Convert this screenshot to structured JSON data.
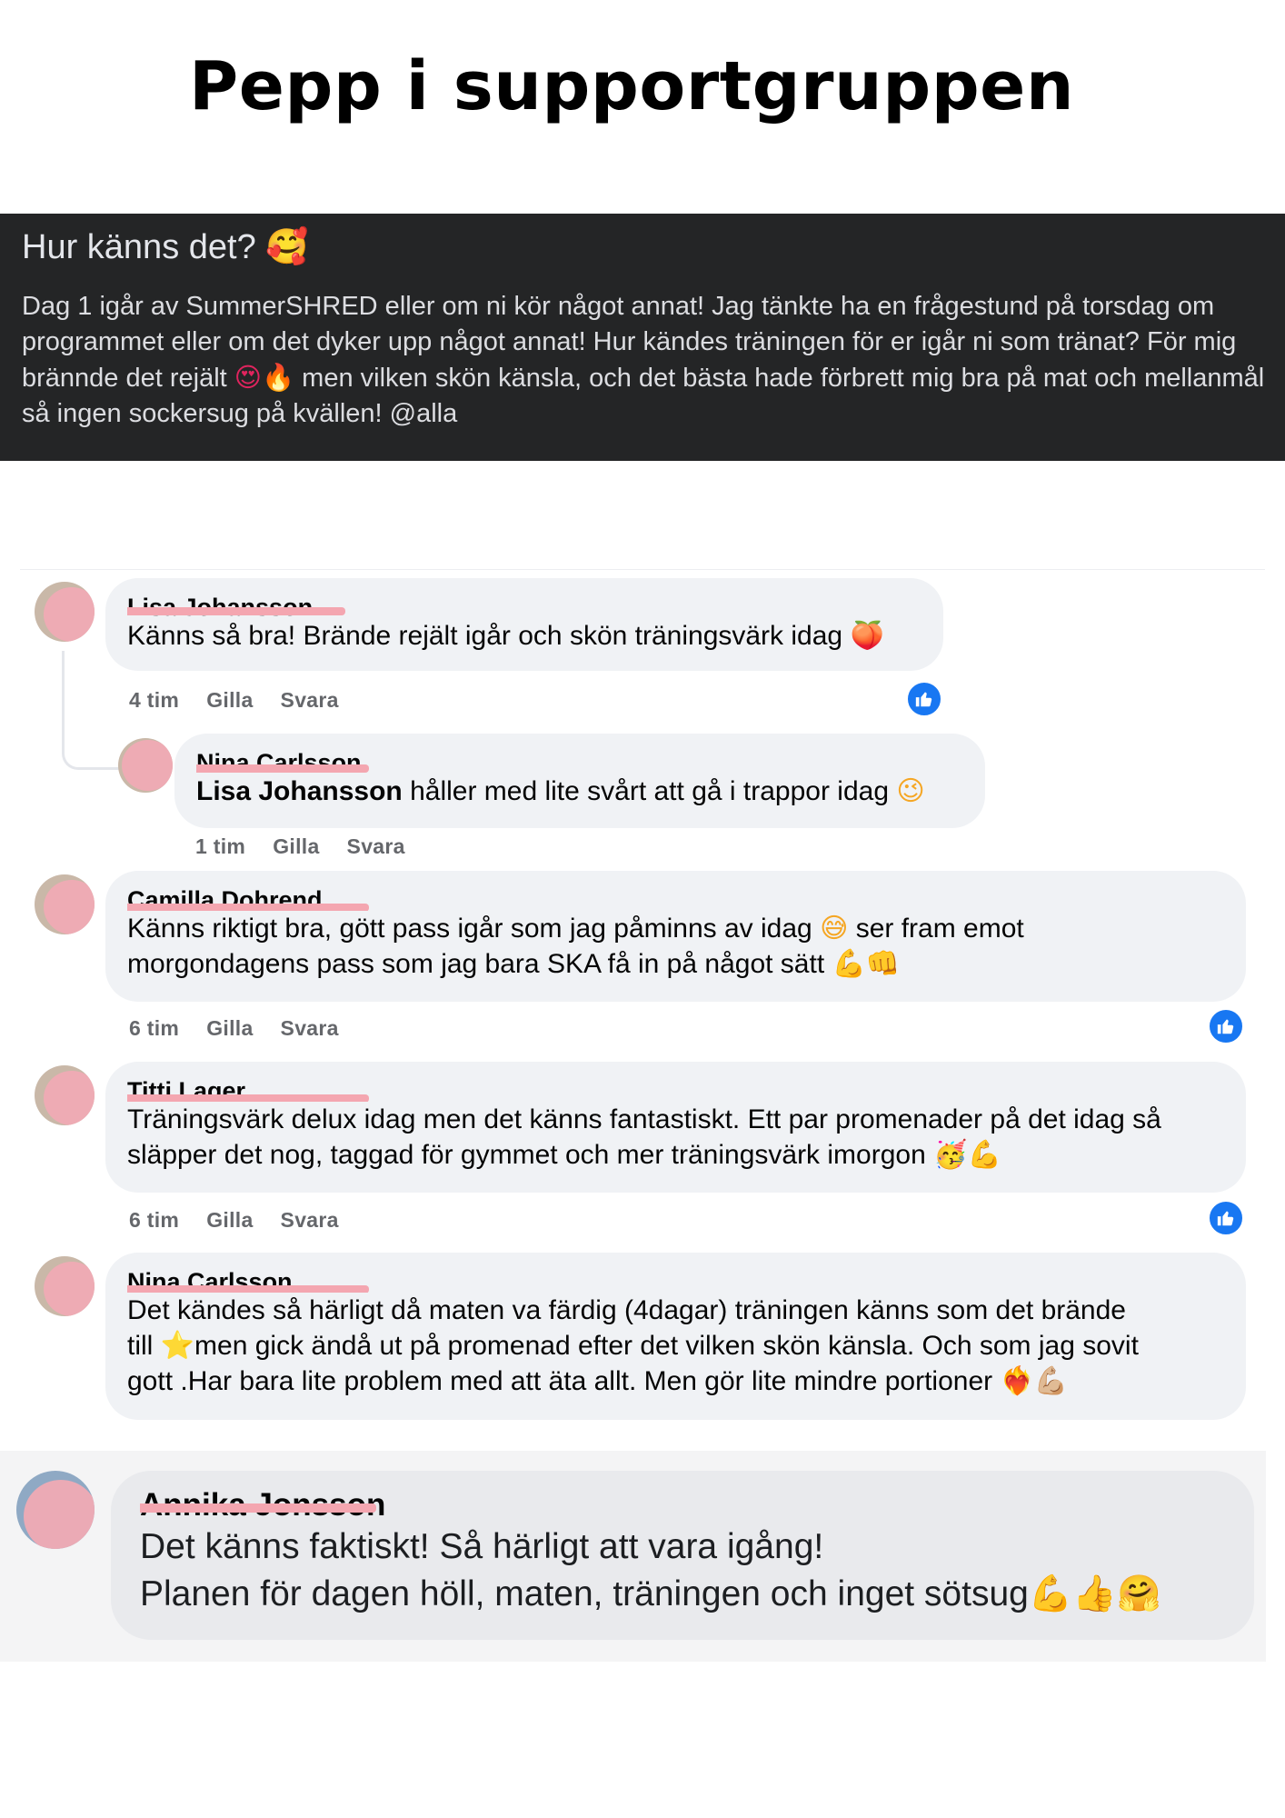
{
  "page_title": "Pepp i supportgruppen",
  "post": {
    "title": "Hur känns det?",
    "title_emoji": "🥰",
    "body_part1": "Dag 1 igår av SummerSHRED eller om ni kör något annat! Jag tänkte ha en frågestund på torsdag om programmet eller om det dyker upp något annat! Hur kändes träningen för er igår ni som tränat? För mig brännde det rejält ",
    "body_emoji": "😍🔥",
    "body_part2": " men vilken skön känsla, och det bästa hade förbrett mig bra på mat och mellanmål så ingen sockersug på kvällen! @alla"
  },
  "comments": [
    {
      "author": "Lisa Johansson",
      "text": "Känns så bra! Brände rejält igår och skön träningsvärk idag",
      "emoji": "🍑",
      "time": "4 tim",
      "like": "Gilla",
      "reply": "Svara",
      "reaction": "like"
    },
    {
      "author": "Nina Carlsson",
      "mention": "Lisa Johansson",
      "text": " håller med lite svårt att gå i trappor idag",
      "emoji": "😉",
      "time": "1 tim",
      "like": "Gilla",
      "reply": "Svara"
    },
    {
      "author": "Camilla Dohrend",
      "text_line1": "Känns riktigt bra, gött pass igår som jag påminns av idag",
      "emoji1": "😅",
      "text_line1b": " ser fram emot",
      "text_line2": "morgondagens pass som jag bara SKA få in på något sätt",
      "emoji2": "💪👊",
      "time": "6 tim",
      "like": "Gilla",
      "reply": "Svara",
      "reaction": "like"
    },
    {
      "author": "Titti Lager",
      "text_line1": "Träningsvärk delux idag men det känns fantastiskt. Ett par promenader på det idag så",
      "text_line2": "släpper det nog, taggad för gymmet och mer träningsvärk imorgon",
      "emoji": "🥳💪",
      "time": "6 tim",
      "like": "Gilla",
      "reply": "Svara",
      "reaction": "like"
    },
    {
      "author": "Nina Carlsson",
      "text_line1": "Det kändes så härligt då maten va färdig (4dagar) träningen känns som det brände",
      "text_line2a": "till ",
      "emoji1": "⭐",
      "text_line2b": "men gick ändå ut på promenad efter det vilken skön känsla. Och som jag sovit",
      "text_line3": "gott .Har bara lite problem med att äta allt. Men gör lite mindre portioner",
      "emoji2": "❤️‍🔥💪🏼"
    },
    {
      "author": "Annika Jonsson",
      "text_line1": "Det känns faktiskt! Så härligt att vara igång!",
      "text_line2": "Planen för dagen höll, maten, träningen och inget sötsug",
      "emoji": "💪👍🤗"
    }
  ],
  "colors": {
    "post_header_bg": "#242526",
    "bubble_bg": "#f0f2f5",
    "like_blue": "#1877f2",
    "redaction_pink": "#f4a6b0"
  }
}
